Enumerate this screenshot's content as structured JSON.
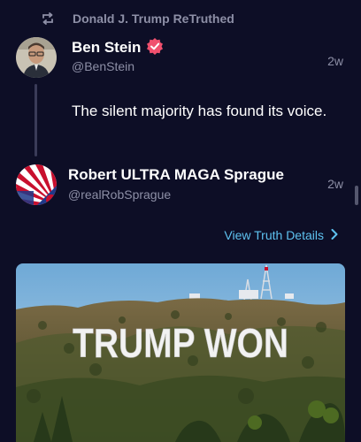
{
  "retruth": {
    "icon": "retruth-icon",
    "text": "Donald J. Trump ReTruthed"
  },
  "post": {
    "author": {
      "name": "Ben Stein",
      "handle": "@BenStein",
      "verified": true,
      "avatar_icon": "avatar-ben-stein"
    },
    "time": "2w",
    "text": "The silent majority has found its voice."
  },
  "reply_author": {
    "name": "Robert ULTRA MAGA Sprague",
    "handle": "@realRobSprague",
    "avatar_icon": "avatar-rising-sun-flag"
  },
  "reply_time": "2w",
  "view_details": {
    "label": "View Truth Details",
    "icon": "chevron-right-icon"
  },
  "media": {
    "sign_text": "TRUMP WON"
  },
  "colors": {
    "background": "#0d0e26",
    "muted": "#8d8fa6",
    "link": "#5ec2f0",
    "verified_badge": "#f0506e"
  }
}
